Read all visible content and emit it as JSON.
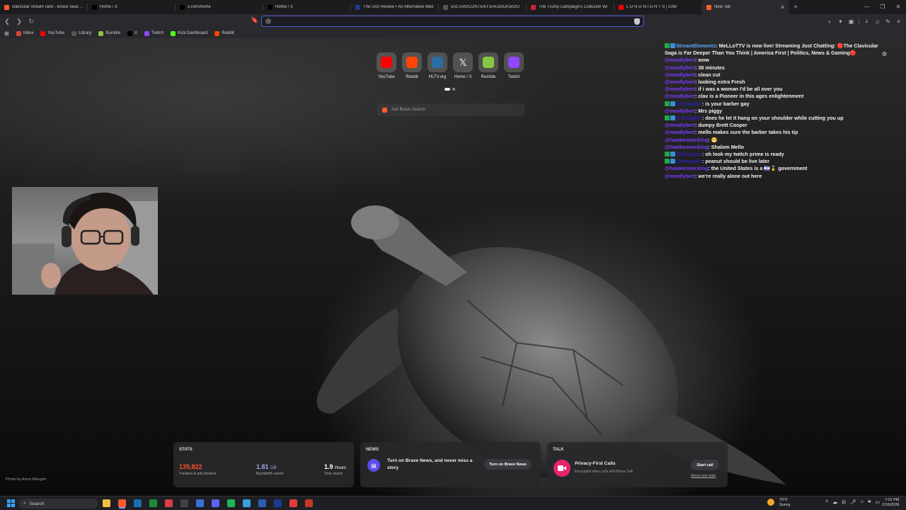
{
  "browser": {
    "tabs": [
      {
        "title": "clavicular stream rank - Brave Search",
        "icon": "brave-search-icon",
        "color": "#ff5b2e"
      },
      {
        "title": "Home / X",
        "icon": "x-icon",
        "color": "#000000"
      },
      {
        "title": "x.com/home",
        "icon": "x-icon",
        "color": "#000000"
      },
      {
        "title": "Home / X",
        "icon": "x-icon",
        "color": "#000000"
      },
      {
        "title": "The Unz Review • An Alternative Med",
        "icon": "unz-icon",
        "color": "#1a3b8f"
      },
      {
        "title": "unz.com/CONTENTS/AUDIO/runz/U",
        "icon": "globe-icon",
        "color": "#555555"
      },
      {
        "title": "The Trump Campaign's Collusion Wi",
        "icon": "site-icon",
        "color": "#cc2233"
      },
      {
        "title": "L O N G   N I G H T S | Chill",
        "icon": "youtube-icon",
        "color": "#ff0000"
      },
      {
        "title": "New Tab",
        "icon": "brave-icon",
        "color": "#ff5b2e",
        "active": true
      }
    ],
    "url_value": "",
    "bookmarks": [
      {
        "label": "Inbox",
        "color": "#d44638"
      },
      {
        "label": "YouTube",
        "color": "#ff0000"
      },
      {
        "label": "Library",
        "color": "#555555"
      },
      {
        "label": "Rumble",
        "color": "#85c742"
      },
      {
        "label": "X",
        "color": "#000000"
      },
      {
        "label": "Twitch",
        "color": "#9146ff"
      },
      {
        "label": "Kick Dashboard",
        "color": "#53fc18"
      },
      {
        "label": "Reddit",
        "color": "#ff4500"
      }
    ]
  },
  "newtab": {
    "top_sites": [
      {
        "label": "YouTube",
        "icon": "youtube-icon",
        "color": "#ff0000"
      },
      {
        "label": "Reddit",
        "icon": "reddit-icon",
        "color": "#ff4500"
      },
      {
        "label": "HLTV.org",
        "icon": "hltv-icon",
        "color": "#2b6ea6"
      },
      {
        "label": "Home / X",
        "icon": "x-icon",
        "color": "#000000"
      },
      {
        "label": "Rumble",
        "icon": "rumble-icon",
        "color": "#85c742"
      },
      {
        "label": "Twitch",
        "icon": "twitch-icon",
        "color": "#9146ff"
      }
    ],
    "search_placeholder": "Ask Brave Search",
    "photo_credit": "Photo by Anna Wangler",
    "stats": {
      "title": "STATS",
      "trackers_value": "135,822",
      "trackers_label": "Trackers & ads blocked",
      "bandwidth_value": "1.81",
      "bandwidth_unit": "GB",
      "bandwidth_label": "Bandwidth saved",
      "time_value": "1.9",
      "time_unit": "Hours",
      "time_label": "Time saved"
    },
    "news": {
      "title": "NEWS",
      "text": "Turn on Brave News, and never miss a story",
      "button": "Turn on Brave News"
    },
    "talk": {
      "title": "TALK",
      "heading": "Privacy-First Calls",
      "sub": "Encrypted video calls with Brave Talk",
      "button": "Start call",
      "link": "About your data"
    }
  },
  "chat": {
    "messages": [
      {
        "user": "StreamElements",
        "ucls": "se",
        "text": "MeLLoTTV is now live! Streaming Just Chatting: 🔴The Clavicular",
        "badges": [
          "#1fa84a",
          "#3a8fd6"
        ]
      },
      {
        "user": "",
        "ucls": "",
        "text": "Saga is Far Deeper Than You Think | America First | Politics, News & Gaming🔴",
        "badges": []
      },
      {
        "user": "@meallybert",
        "ucls": "u",
        "text": "wow",
        "badges": []
      },
      {
        "user": "@meallybert",
        "ucls": "u",
        "text": "38 minutes",
        "badges": []
      },
      {
        "user": "@meallybert",
        "ucls": "u",
        "text": "clean cut",
        "badges": []
      },
      {
        "user": "@meallybert",
        "ucls": "u",
        "text": "looking extra Fresh",
        "badges": []
      },
      {
        "user": "@meallybert",
        "ucls": "u",
        "text": "if i was a woman I'd be all over you",
        "badges": []
      },
      {
        "user": "@meallybert",
        "ucls": "u",
        "text": "clav is a Pioneer in this ages enlightenment",
        "badges": []
      },
      {
        "user": "@thepalier",
        "ucls": "u2",
        "text": "is your barber gay",
        "badges": [
          "#1fa84a",
          "#3a8fd6"
        ]
      },
      {
        "user": "@meallybert",
        "ucls": "u",
        "text": "Mrs piggy",
        "badges": []
      },
      {
        "user": "@thepalier",
        "ucls": "u2",
        "text": "does he let it hang on your shoulder while cutting you up",
        "badges": [
          "#1fa84a",
          "#3a8fd6"
        ]
      },
      {
        "user": "@meallybert",
        "ucls": "u",
        "text": "dumpy Brett Cooper",
        "badges": []
      },
      {
        "user": "@meallybert",
        "ucls": "u",
        "text": "mello makes sure the barber takes his tip",
        "badges": []
      },
      {
        "user": "@hawkermocking",
        "ucls": "u",
        "text": "😬",
        "badges": []
      },
      {
        "user": "@hawkermocking",
        "ucls": "u",
        "text": "Shalom Mello",
        "badges": []
      },
      {
        "user": "@thepalier",
        "ucls": "u2",
        "text": "oh look my twitch prime is ready",
        "badges": [
          "#1fa84a",
          "#3a8fd6"
        ]
      },
      {
        "user": "@thepalier",
        "ucls": "u2",
        "text": "peanut should be live later",
        "badges": [
          "#1fa84a",
          "#3a8fd6"
        ]
      },
      {
        "user": "@hawkermocking",
        "ucls": "u",
        "text": "the United States is a 🇮🇱🎖️ government",
        "badges": []
      },
      {
        "user": "@meallybert",
        "ucls": "u",
        "text": "we're really alone out here",
        "badges": []
      }
    ]
  },
  "taskbar": {
    "search_label": "Search",
    "apps": [
      {
        "icon": "file-explorer-icon",
        "color": "#f0c040"
      },
      {
        "icon": "brave-icon",
        "color": "#ff5b2e"
      },
      {
        "icon": "steam-icon",
        "color": "#1b6fae"
      },
      {
        "icon": "spreadsheet-icon",
        "color": "#1d8a3a"
      },
      {
        "icon": "app-icon",
        "color": "#d94040"
      },
      {
        "icon": "obs-icon",
        "color": "#444444"
      },
      {
        "icon": "app2-icon",
        "color": "#3a6fd6"
      },
      {
        "icon": "discord-icon",
        "color": "#5865f2"
      },
      {
        "icon": "spotify-icon",
        "color": "#1db954"
      },
      {
        "icon": "app3-icon",
        "color": "#3aa0e0"
      },
      {
        "icon": "app4-icon",
        "color": "#2a5db0"
      },
      {
        "icon": "app5-icon",
        "color": "#1a3b8f"
      },
      {
        "icon": "app6-icon",
        "color": "#e33b3b"
      },
      {
        "icon": "app7-icon",
        "color": "#c0392b"
      }
    ],
    "weather_temp": "70°F",
    "weather_cond": "Sunny",
    "time": "7:01 PM",
    "date": "2/16/2026"
  }
}
